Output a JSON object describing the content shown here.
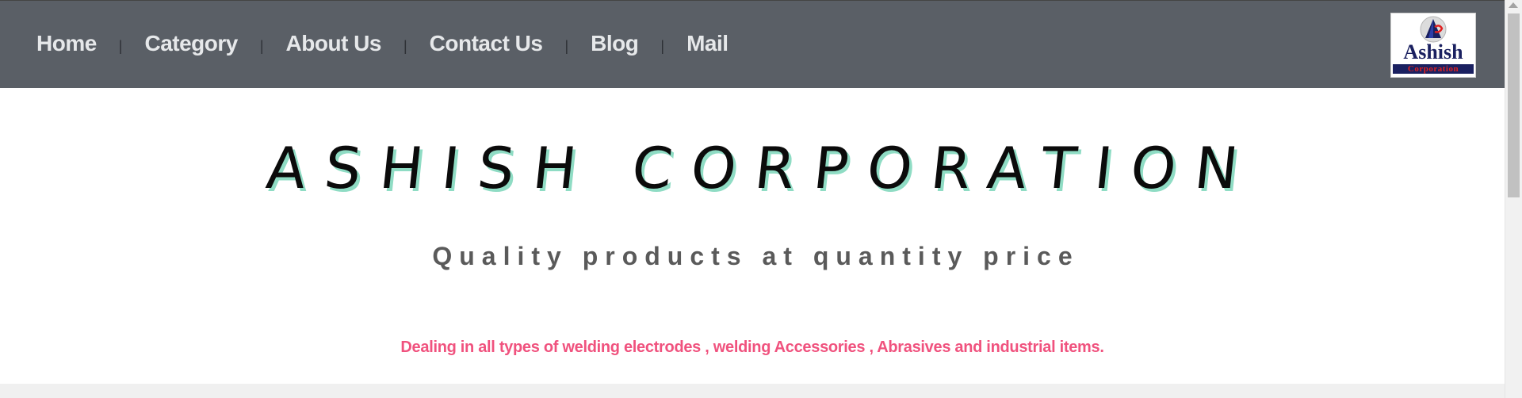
{
  "nav": {
    "items": [
      {
        "label": "Home"
      },
      {
        "label": "Category"
      },
      {
        "label": "About Us"
      },
      {
        "label": "Contact Us"
      },
      {
        "label": "Blog"
      },
      {
        "label": "Mail"
      }
    ],
    "separator": "|"
  },
  "logo": {
    "line1": "Ashish",
    "line2": "Corporation"
  },
  "hero": {
    "title": "ASHISH CORPORATION",
    "tagline": "Quality products at quantity price",
    "dealing": "Dealing in all types of welding electrodes , welding Accessories , Abrasives and industrial items."
  },
  "colors": {
    "navbar_bg": "#5a5f66",
    "nav_text": "#e6e8ea",
    "title_shadow": "#8fdcc4",
    "dealing_text": "#f0527e",
    "logo_navy": "#1a2060",
    "logo_red": "#e02020"
  }
}
